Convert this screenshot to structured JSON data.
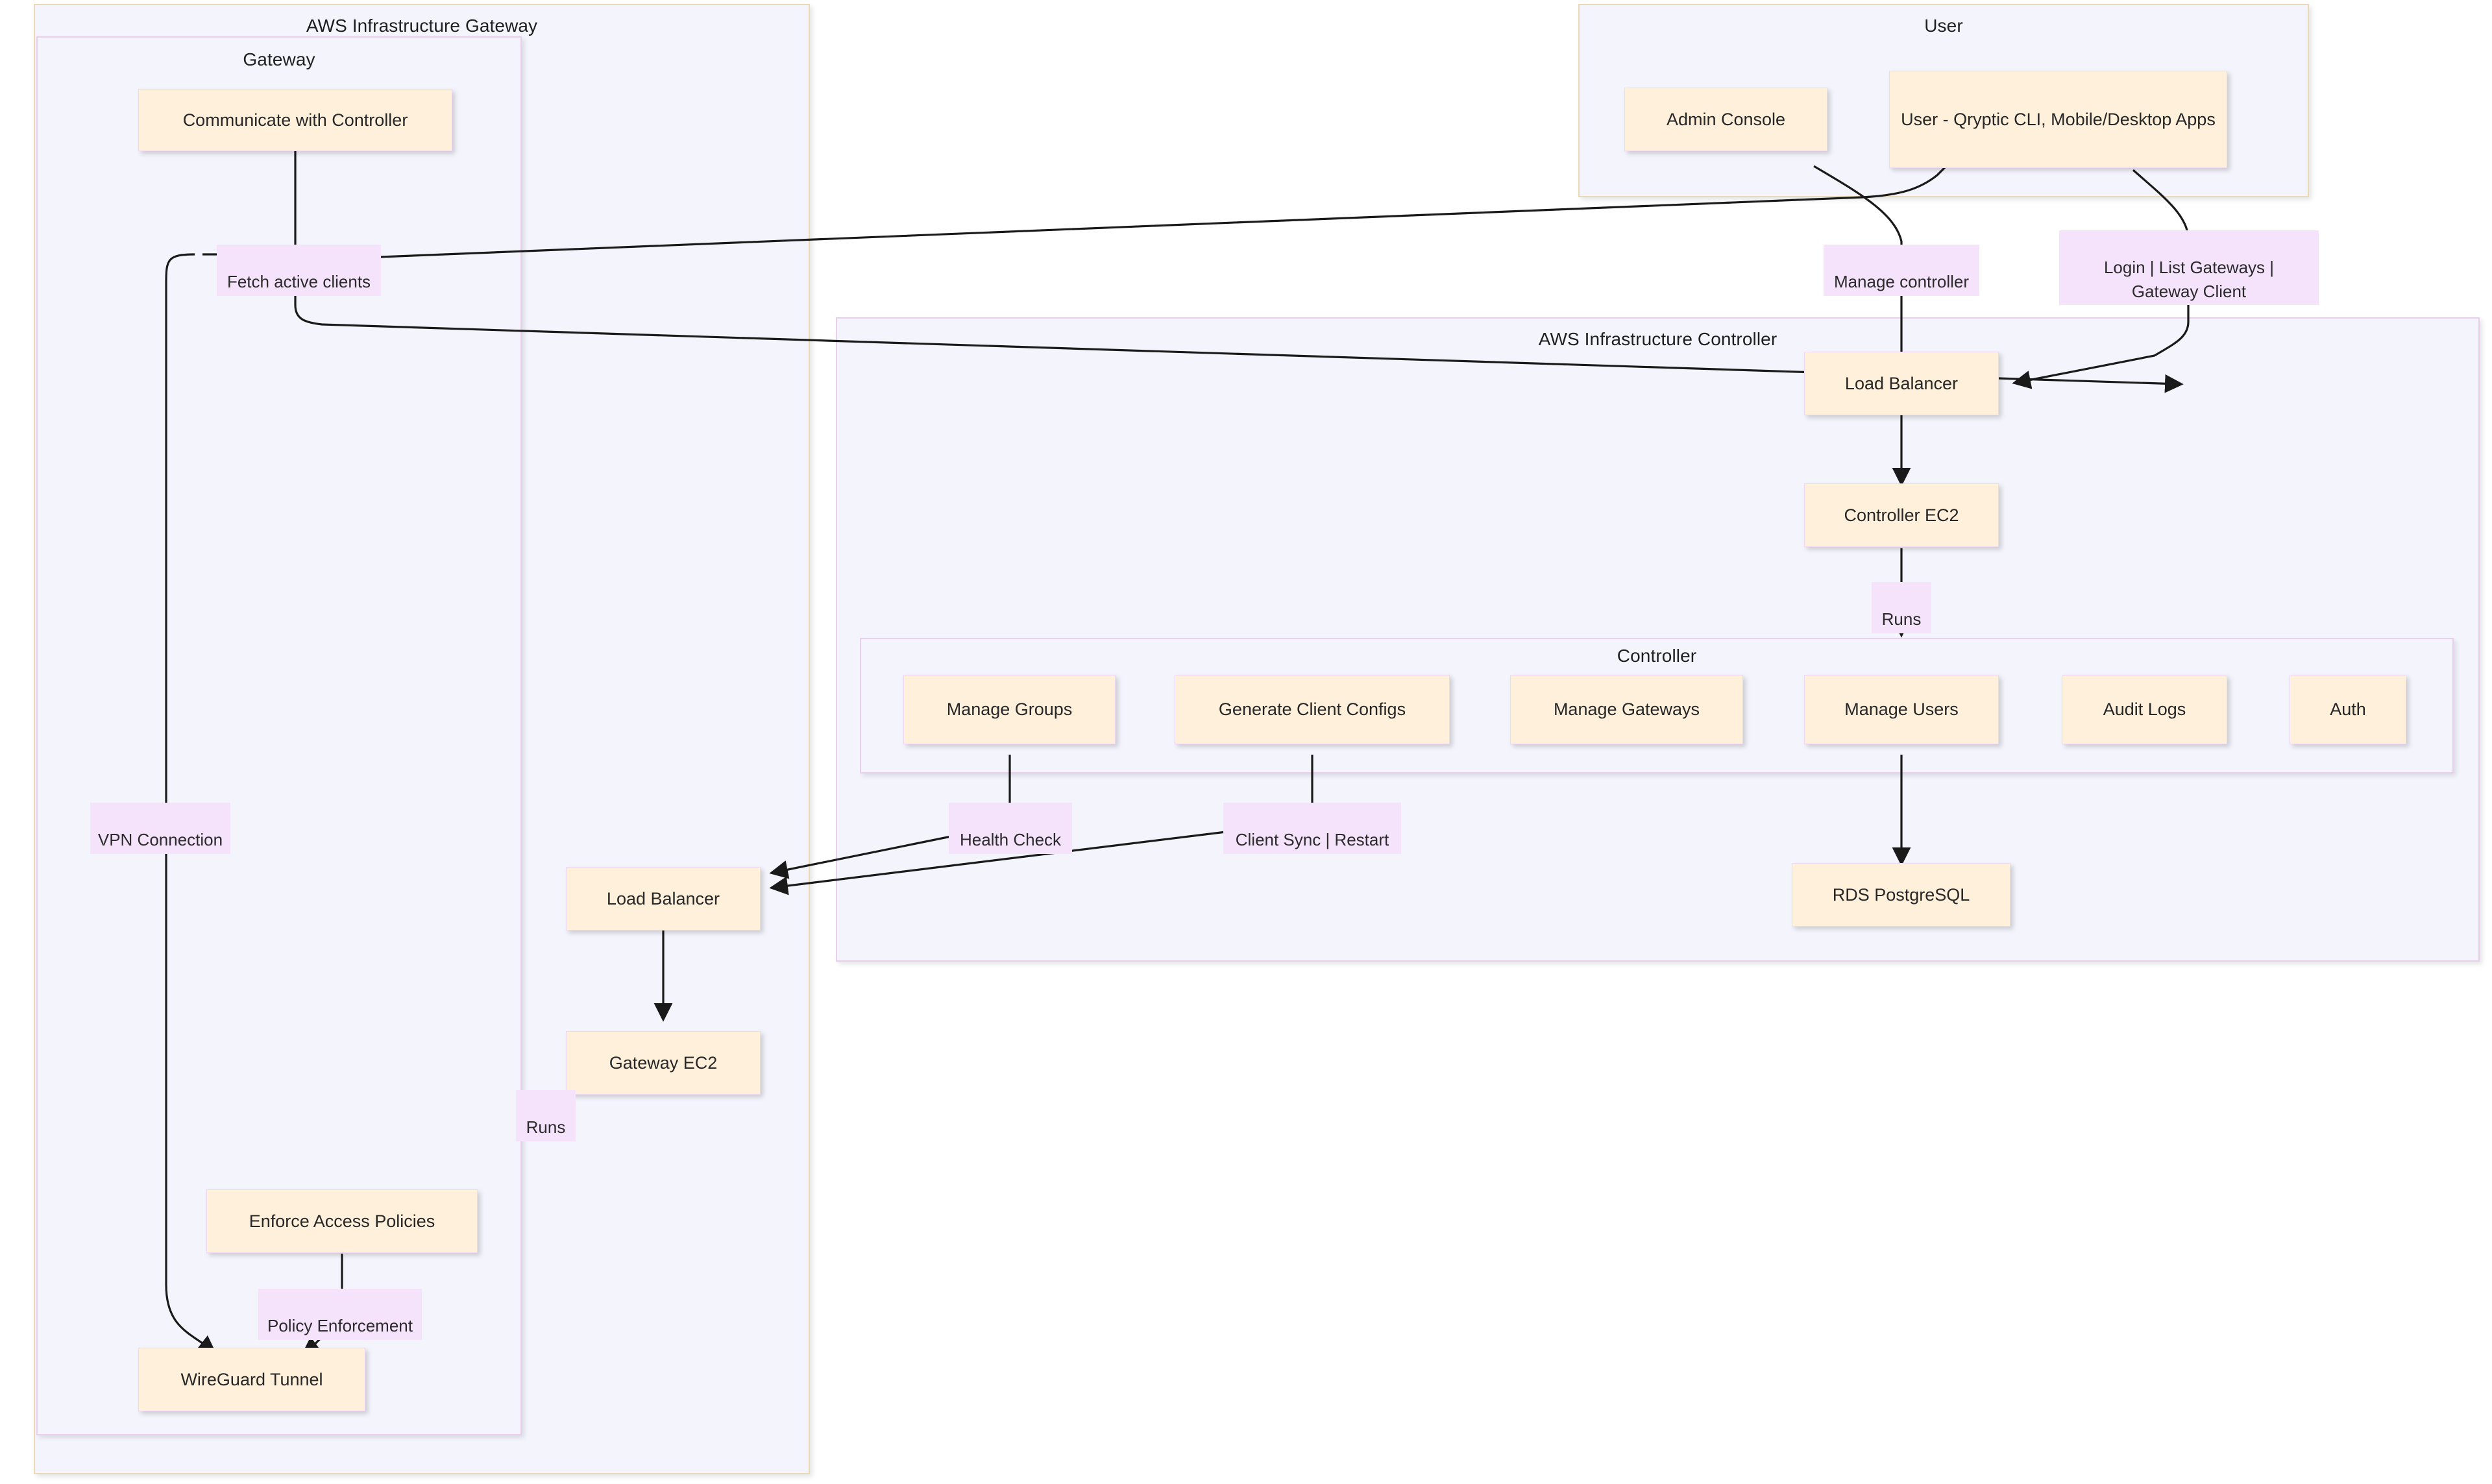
{
  "diagram": {
    "title": "Qryptic AWS Infrastructure Architecture",
    "type": "flowchart",
    "colors": {
      "node_fill": "#FEF0DA",
      "node_border": "#EFD9F2",
      "cluster_fill": "#F4F4FC",
      "cluster_border_tan": "#EAD8B6",
      "cluster_border_lavender": "#E9CEEE",
      "edge_label_fill": "#F5E3FB",
      "edge_stroke": "#1a1a1a",
      "text": "#272727"
    }
  },
  "clusters": [
    {
      "id": "aws_gateway",
      "title": "AWS Infrastructure Gateway"
    },
    {
      "id": "gateway",
      "title": "Gateway"
    },
    {
      "id": "user",
      "title": "User"
    },
    {
      "id": "aws_controller",
      "title": "AWS Infrastructure Controller"
    },
    {
      "id": "controller",
      "title": "Controller"
    }
  ],
  "nodes": [
    {
      "id": "communicate_with_controller",
      "label": "Communicate with Controller",
      "cluster": "gateway"
    },
    {
      "id": "enforce_access_policies",
      "label": "Enforce Access Policies",
      "cluster": "gateway"
    },
    {
      "id": "wireguard_tunnel",
      "label": "WireGuard Tunnel",
      "cluster": "gateway"
    },
    {
      "id": "gateway_load_balancer",
      "label": "Load Balancer",
      "cluster": "aws_gateway"
    },
    {
      "id": "gateway_ec2",
      "label": "Gateway EC2",
      "cluster": "aws_gateway"
    },
    {
      "id": "admin_console",
      "label": "Admin Console",
      "cluster": "user"
    },
    {
      "id": "user_clients",
      "label": "User - Qryptic CLI,\nMobile/Desktop Apps",
      "cluster": "user"
    },
    {
      "id": "controller_load_balancer",
      "label": "Load Balancer",
      "cluster": "aws_controller"
    },
    {
      "id": "controller_ec2",
      "label": "Controller EC2",
      "cluster": "aws_controller"
    },
    {
      "id": "rds_postgresql",
      "label": "RDS PostgreSQL",
      "cluster": "aws_controller"
    },
    {
      "id": "manage_groups",
      "label": "Manage Groups",
      "cluster": "controller"
    },
    {
      "id": "generate_client_configs",
      "label": "Generate Client Configs",
      "cluster": "controller"
    },
    {
      "id": "manage_gateways",
      "label": "Manage Gateways",
      "cluster": "controller"
    },
    {
      "id": "manage_users",
      "label": "Manage Users",
      "cluster": "controller"
    },
    {
      "id": "audit_logs",
      "label": "Audit Logs",
      "cluster": "controller"
    },
    {
      "id": "auth",
      "label": "Auth",
      "cluster": "controller"
    }
  ],
  "edge_labels": [
    {
      "id": "fetch_active_clients",
      "label": "Fetch active clients"
    },
    {
      "id": "manage_controller",
      "label": "Manage controller"
    },
    {
      "id": "login_list_gateways",
      "label": "Login | List Gateways |\nGateway Client"
    },
    {
      "id": "vpn_connection",
      "label": "VPN Connection"
    },
    {
      "id": "runs_controller",
      "label": "Runs"
    },
    {
      "id": "health_check",
      "label": "Health Check"
    },
    {
      "id": "client_sync_restart",
      "label": "Client Sync | Restart"
    },
    {
      "id": "runs_gateway",
      "label": "Runs"
    },
    {
      "id": "policy_enforcement",
      "label": "Policy Enforcement"
    }
  ],
  "edges": [
    {
      "from": "communicate_with_controller",
      "to": "controller_load_balancer",
      "label": "Fetch active clients"
    },
    {
      "from": "communicate_with_controller",
      "to": "wireguard_tunnel",
      "label": "VPN Connection"
    },
    {
      "from": "admin_console",
      "to": "controller_load_balancer",
      "label": "Manage controller"
    },
    {
      "from": "user_clients",
      "to": "controller_load_balancer",
      "label": "Login | List Gateways | Gateway Client"
    },
    {
      "from": "controller_load_balancer",
      "to": "controller_ec2",
      "label": ""
    },
    {
      "from": "controller_ec2",
      "to": "controller",
      "label": "Runs"
    },
    {
      "from": "manage_users",
      "to": "rds_postgresql",
      "label": ""
    },
    {
      "from": "manage_groups",
      "to": "gateway_load_balancer",
      "label": "Health Check"
    },
    {
      "from": "generate_client_configs",
      "to": "gateway_load_balancer",
      "label": "Client Sync | Restart"
    },
    {
      "from": "gateway_load_balancer",
      "to": "gateway_ec2",
      "label": ""
    },
    {
      "from": "gateway_ec2",
      "to": "gateway",
      "label": "Runs"
    },
    {
      "from": "enforce_access_policies",
      "to": "wireguard_tunnel",
      "label": "Policy Enforcement"
    }
  ]
}
